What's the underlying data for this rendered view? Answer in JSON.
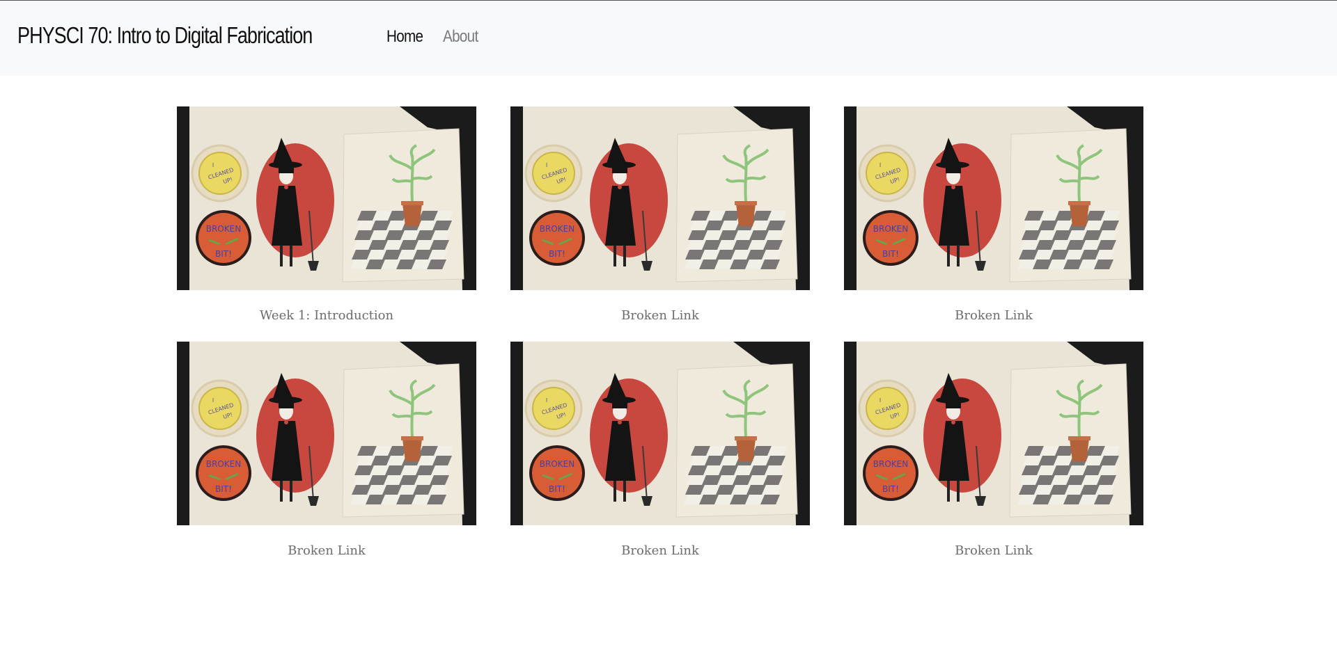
{
  "navbar": {
    "brand": "PHYSCI 70: Intro to Digital Fabrication",
    "links": [
      {
        "label": "Home",
        "active": true
      },
      {
        "label": "About",
        "active": false
      }
    ]
  },
  "gallery": {
    "items": [
      {
        "caption": "Week 1: Introduction",
        "image": "embroidery-patches-image"
      },
      {
        "caption": "Broken Link",
        "image": "embroidery-patches-image"
      },
      {
        "caption": "Broken Link",
        "image": "embroidery-patches-image"
      },
      {
        "caption": "Broken Link",
        "image": "embroidery-patches-image"
      },
      {
        "caption": "Broken Link",
        "image": "embroidery-patches-image"
      },
      {
        "caption": "Broken Link",
        "image": "embroidery-patches-image"
      }
    ],
    "patch_text": {
      "top_badge": [
        "I",
        "CLEANED",
        "UP!"
      ],
      "bottom_badge": [
        "BROKEN",
        "BIT!"
      ]
    }
  },
  "colors": {
    "navbar_bg": "#f8f9fa",
    "caption_text": "#6c6c6c",
    "fabric": "#e9e4d6",
    "dark_fabric": "#1b1b1b",
    "red_oval": "#c8473f",
    "yellow_badge": "#e9d862",
    "orange_badge": "#d85c35",
    "plant_green": "#8fc47d",
    "pot": "#b4623a"
  }
}
